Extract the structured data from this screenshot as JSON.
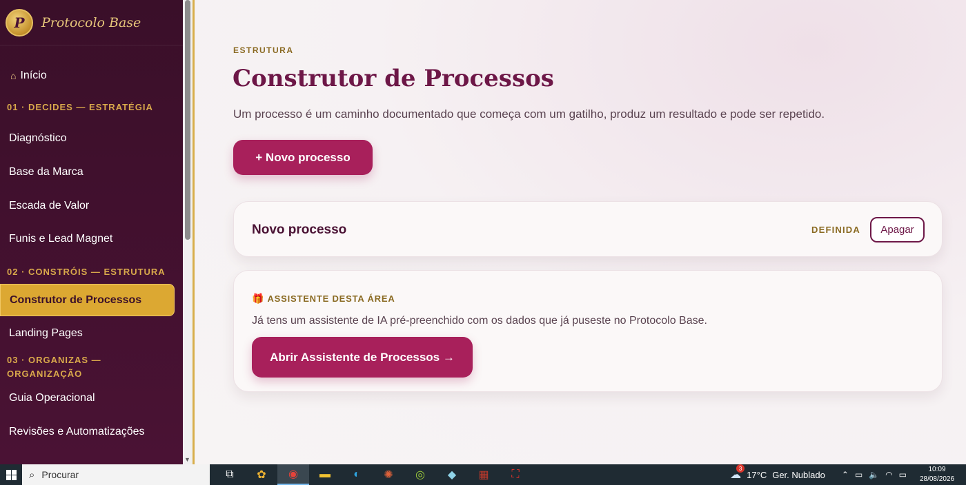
{
  "brand": {
    "logo_letter": "P",
    "name": "Protocolo Base"
  },
  "sidebar": {
    "home_label": "Início",
    "sections": [
      {
        "title": "01 · DECIDES — ESTRATÉGIA",
        "items": [
          "Diagnóstico",
          "Base da Marca",
          "Escada de Valor",
          "Funis e Lead Magnet"
        ]
      },
      {
        "title": "02 · CONSTRÓIS — ESTRUTURA",
        "items": [
          "Construtor de Processos",
          "Landing Pages"
        ]
      },
      {
        "title_line1": "03 · ORGANIZAS —",
        "title_line2": "ORGANIZAÇÃO",
        "items": [
          "Guia Operacional",
          "Revisões e Automatizações"
        ]
      }
    ],
    "active_item": "Construtor de Processos"
  },
  "main": {
    "eyebrow": "ESTRUTURA",
    "title": "Construtor de Processos",
    "description": "Um processo é um caminho documentado que começa com um gatilho, produz um resultado e pode ser repetido.",
    "new_button": "+ Novo processo",
    "process_card": {
      "name": "Novo processo",
      "status": "DEFINIDA",
      "delete_button": "Apagar"
    },
    "assistant_card": {
      "label": "ASSISTENTE DESTA ÁREA",
      "text": "Já tens um assistente de IA pré-preenchido com os dados que já puseste no Protocolo Base.",
      "button": "Abrir Assistente de Processos →"
    }
  },
  "taskbar": {
    "search_placeholder": "Procurar",
    "weather": {
      "temp": "17°C",
      "desc": "Ger. Nublado",
      "badge": "3"
    },
    "time": "10:09",
    "date": "28/08/2026"
  },
  "colors": {
    "primary": "#a8205b",
    "sidebar": "#3a0f29",
    "gold": "#dca832",
    "title": "#6d1747"
  }
}
